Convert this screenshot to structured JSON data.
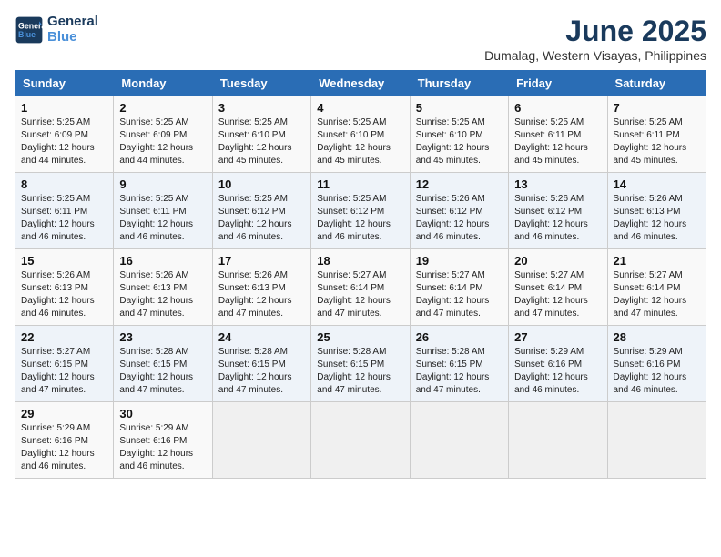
{
  "header": {
    "logo_line1": "General",
    "logo_line2": "Blue",
    "title": "June 2025",
    "subtitle": "Dumalag, Western Visayas, Philippines"
  },
  "weekdays": [
    "Sunday",
    "Monday",
    "Tuesday",
    "Wednesday",
    "Thursday",
    "Friday",
    "Saturday"
  ],
  "weeks": [
    [
      {
        "day": "1",
        "sunrise": "5:25 AM",
        "sunset": "6:09 PM",
        "daylight": "12 hours and 44 minutes."
      },
      {
        "day": "2",
        "sunrise": "5:25 AM",
        "sunset": "6:09 PM",
        "daylight": "12 hours and 44 minutes."
      },
      {
        "day": "3",
        "sunrise": "5:25 AM",
        "sunset": "6:10 PM",
        "daylight": "12 hours and 45 minutes."
      },
      {
        "day": "4",
        "sunrise": "5:25 AM",
        "sunset": "6:10 PM",
        "daylight": "12 hours and 45 minutes."
      },
      {
        "day": "5",
        "sunrise": "5:25 AM",
        "sunset": "6:10 PM",
        "daylight": "12 hours and 45 minutes."
      },
      {
        "day": "6",
        "sunrise": "5:25 AM",
        "sunset": "6:11 PM",
        "daylight": "12 hours and 45 minutes."
      },
      {
        "day": "7",
        "sunrise": "5:25 AM",
        "sunset": "6:11 PM",
        "daylight": "12 hours and 45 minutes."
      }
    ],
    [
      {
        "day": "8",
        "sunrise": "5:25 AM",
        "sunset": "6:11 PM",
        "daylight": "12 hours and 46 minutes."
      },
      {
        "day": "9",
        "sunrise": "5:25 AM",
        "sunset": "6:11 PM",
        "daylight": "12 hours and 46 minutes."
      },
      {
        "day": "10",
        "sunrise": "5:25 AM",
        "sunset": "6:12 PM",
        "daylight": "12 hours and 46 minutes."
      },
      {
        "day": "11",
        "sunrise": "5:25 AM",
        "sunset": "6:12 PM",
        "daylight": "12 hours and 46 minutes."
      },
      {
        "day": "12",
        "sunrise": "5:26 AM",
        "sunset": "6:12 PM",
        "daylight": "12 hours and 46 minutes."
      },
      {
        "day": "13",
        "sunrise": "5:26 AM",
        "sunset": "6:12 PM",
        "daylight": "12 hours and 46 minutes."
      },
      {
        "day": "14",
        "sunrise": "5:26 AM",
        "sunset": "6:13 PM",
        "daylight": "12 hours and 46 minutes."
      }
    ],
    [
      {
        "day": "15",
        "sunrise": "5:26 AM",
        "sunset": "6:13 PM",
        "daylight": "12 hours and 46 minutes."
      },
      {
        "day": "16",
        "sunrise": "5:26 AM",
        "sunset": "6:13 PM",
        "daylight": "12 hours and 47 minutes."
      },
      {
        "day": "17",
        "sunrise": "5:26 AM",
        "sunset": "6:13 PM",
        "daylight": "12 hours and 47 minutes."
      },
      {
        "day": "18",
        "sunrise": "5:27 AM",
        "sunset": "6:14 PM",
        "daylight": "12 hours and 47 minutes."
      },
      {
        "day": "19",
        "sunrise": "5:27 AM",
        "sunset": "6:14 PM",
        "daylight": "12 hours and 47 minutes."
      },
      {
        "day": "20",
        "sunrise": "5:27 AM",
        "sunset": "6:14 PM",
        "daylight": "12 hours and 47 minutes."
      },
      {
        "day": "21",
        "sunrise": "5:27 AM",
        "sunset": "6:14 PM",
        "daylight": "12 hours and 47 minutes."
      }
    ],
    [
      {
        "day": "22",
        "sunrise": "5:27 AM",
        "sunset": "6:15 PM",
        "daylight": "12 hours and 47 minutes."
      },
      {
        "day": "23",
        "sunrise": "5:28 AM",
        "sunset": "6:15 PM",
        "daylight": "12 hours and 47 minutes."
      },
      {
        "day": "24",
        "sunrise": "5:28 AM",
        "sunset": "6:15 PM",
        "daylight": "12 hours and 47 minutes."
      },
      {
        "day": "25",
        "sunrise": "5:28 AM",
        "sunset": "6:15 PM",
        "daylight": "12 hours and 47 minutes."
      },
      {
        "day": "26",
        "sunrise": "5:28 AM",
        "sunset": "6:15 PM",
        "daylight": "12 hours and 47 minutes."
      },
      {
        "day": "27",
        "sunrise": "5:29 AM",
        "sunset": "6:16 PM",
        "daylight": "12 hours and 46 minutes."
      },
      {
        "day": "28",
        "sunrise": "5:29 AM",
        "sunset": "6:16 PM",
        "daylight": "12 hours and 46 minutes."
      }
    ],
    [
      {
        "day": "29",
        "sunrise": "5:29 AM",
        "sunset": "6:16 PM",
        "daylight": "12 hours and 46 minutes."
      },
      {
        "day": "30",
        "sunrise": "5:29 AM",
        "sunset": "6:16 PM",
        "daylight": "12 hours and 46 minutes."
      },
      null,
      null,
      null,
      null,
      null
    ]
  ],
  "labels": {
    "sunrise": "Sunrise:",
    "sunset": "Sunset:",
    "daylight": "Daylight:"
  }
}
